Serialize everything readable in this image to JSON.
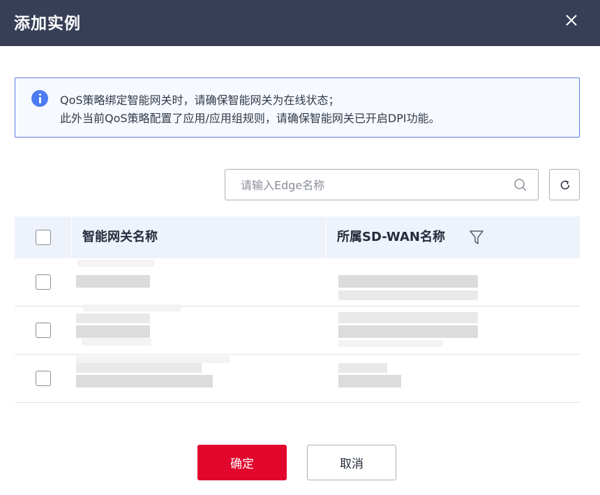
{
  "dialog": {
    "title": "添加实例",
    "close_icon": "close-icon"
  },
  "notice": {
    "icon": "info-icon",
    "color": "#5e7ce0",
    "line1": "QoS策略绑定智能网关时，请确保智能网关为在线状态；",
    "line2": "此外当前QoS策略配置了应用/应用组规则，请确保智能网关已开启DPI功能。"
  },
  "search": {
    "placeholder": "请输入Edge名称",
    "value": "",
    "icon": "search-icon"
  },
  "refresh": {
    "icon": "refresh-icon"
  },
  "table": {
    "columns": [
      "智能网关名称",
      "所属SD-WAN名称"
    ],
    "filter_icon": "filter-icon",
    "rows": [
      {
        "name": "",
        "sdwan": "",
        "checked": false
      },
      {
        "name": "",
        "sdwan": "",
        "checked": false
      },
      {
        "name": "",
        "sdwan": "",
        "checked": false
      }
    ]
  },
  "footer": {
    "confirm_label": "确定",
    "cancel_label": "取消",
    "confirm_color": "#e1062c"
  }
}
